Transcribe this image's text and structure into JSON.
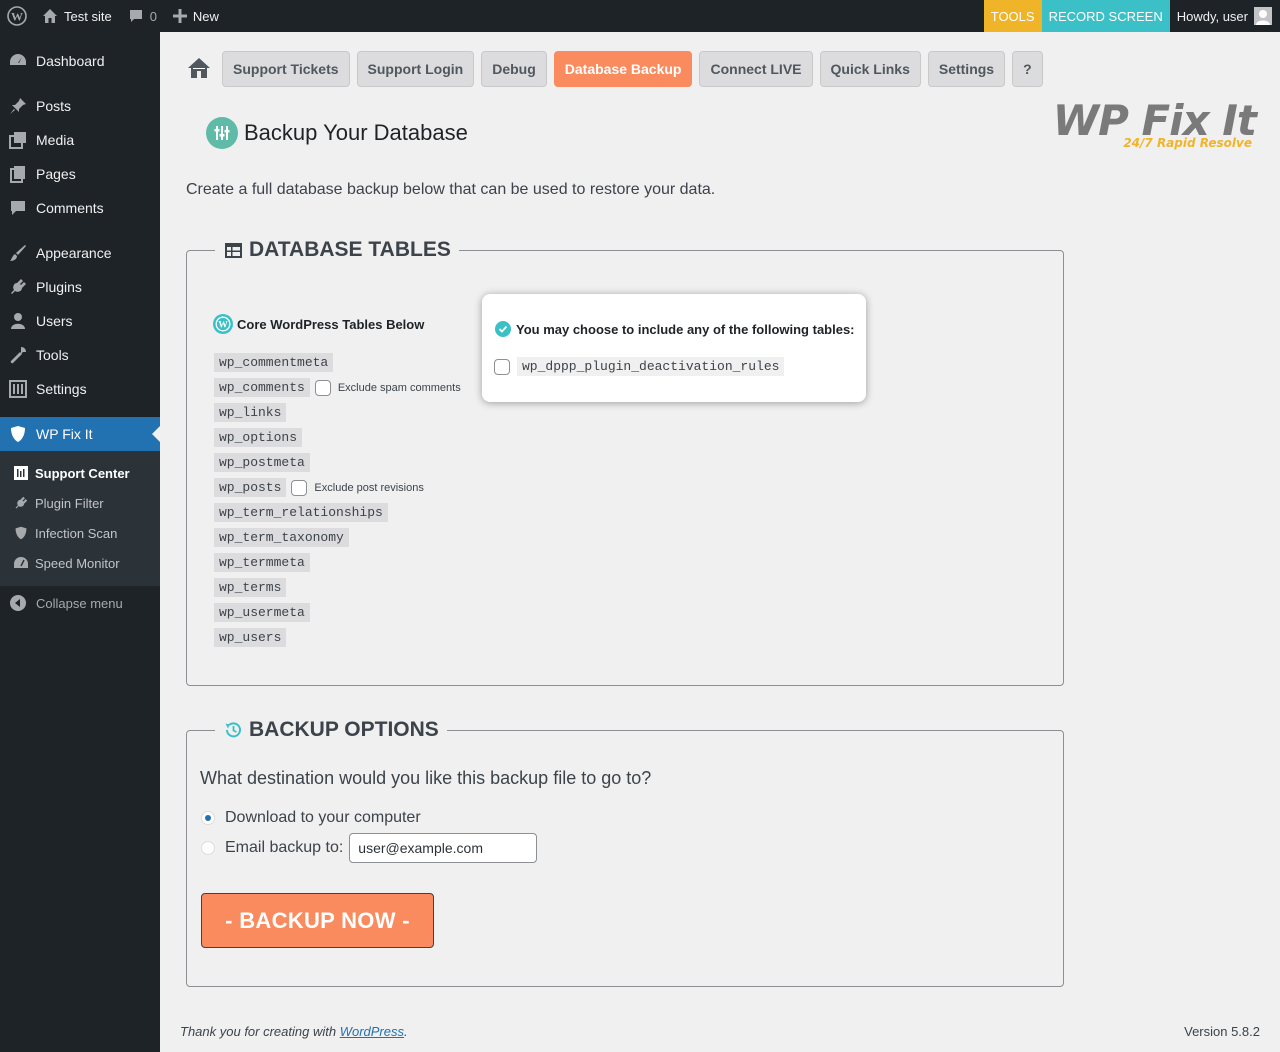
{
  "adminbar": {
    "site_name": "Test site",
    "comments_count": "0",
    "new_label": "New",
    "tools_label": "TOOLS",
    "record_label": "RECORD SCREEN",
    "howdy": "Howdy, user"
  },
  "sidebar": {
    "items": [
      {
        "label": "Dashboard",
        "icon": "dashboard-icon"
      },
      {
        "label": "Posts",
        "icon": "pin-icon"
      },
      {
        "label": "Media",
        "icon": "media-icon"
      },
      {
        "label": "Pages",
        "icon": "pages-icon"
      },
      {
        "label": "Comments",
        "icon": "comments-icon"
      },
      {
        "label": "Appearance",
        "icon": "brush-icon"
      },
      {
        "label": "Plugins",
        "icon": "plugin-icon"
      },
      {
        "label": "Users",
        "icon": "users-icon"
      },
      {
        "label": "Tools",
        "icon": "wrench-icon"
      },
      {
        "label": "Settings",
        "icon": "settings-icon"
      },
      {
        "label": "WP Fix It",
        "icon": "shield-icon"
      }
    ],
    "submenu": [
      {
        "label": "Support Center",
        "icon": "support-icon"
      },
      {
        "label": "Plugin Filter",
        "icon": "plugin-icon"
      },
      {
        "label": "Infection Scan",
        "icon": "shield-icon"
      },
      {
        "label": "Speed Monitor",
        "icon": "gauge-icon"
      }
    ],
    "collapse_label": "Collapse menu"
  },
  "nav": {
    "tabs": [
      "Support Tickets",
      "Support Login",
      "Debug",
      "Database Backup",
      "Connect LIVE",
      "Quick Links",
      "Settings",
      "?"
    ],
    "active": "Database Backup"
  },
  "logo": {
    "title": "WP Fix It",
    "tagline": "24/7 Rapid Resolve"
  },
  "page": {
    "title": "Backup Your Database",
    "intro": "Create a full database backup below that can be used to restore your data."
  },
  "tables_section": {
    "legend": "DATABASE TABLES",
    "core_heading": "Core WordPress Tables Below",
    "core_tables": [
      {
        "name": "wp_commentmeta",
        "option": ""
      },
      {
        "name": "wp_comments",
        "option": "Exclude spam comments"
      },
      {
        "name": "wp_links",
        "option": ""
      },
      {
        "name": "wp_options",
        "option": ""
      },
      {
        "name": "wp_postmeta",
        "option": ""
      },
      {
        "name": "wp_posts",
        "option": "Exclude post revisions"
      },
      {
        "name": "wp_term_relationships",
        "option": ""
      },
      {
        "name": "wp_term_taxonomy",
        "option": ""
      },
      {
        "name": "wp_termmeta",
        "option": ""
      },
      {
        "name": "wp_terms",
        "option": ""
      },
      {
        "name": "wp_usermeta",
        "option": ""
      },
      {
        "name": "wp_users",
        "option": ""
      }
    ],
    "optional_heading": "You may choose to include any of the following tables:",
    "optional_tables": [
      "wp_dppp_plugin_deactivation_rules"
    ]
  },
  "backup_section": {
    "legend": "BACKUP OPTIONS",
    "question": "What destination would you like this backup file to go to?",
    "option_download": "Download to your computer",
    "option_email": "Email backup to:",
    "email_value": "user@example.com",
    "selected": "download",
    "button_label": "- BACKUP NOW -"
  },
  "footer": {
    "thanks_prefix": "Thank you for creating with ",
    "thanks_link": "WordPress",
    "thanks_suffix": ".",
    "version": "Version 5.8.2"
  },
  "colors": {
    "accent_orange": "#f98b5f",
    "accent_teal": "#3bc0c8",
    "tools_yellow": "#f0b429",
    "wp_blue": "#2271b1"
  }
}
